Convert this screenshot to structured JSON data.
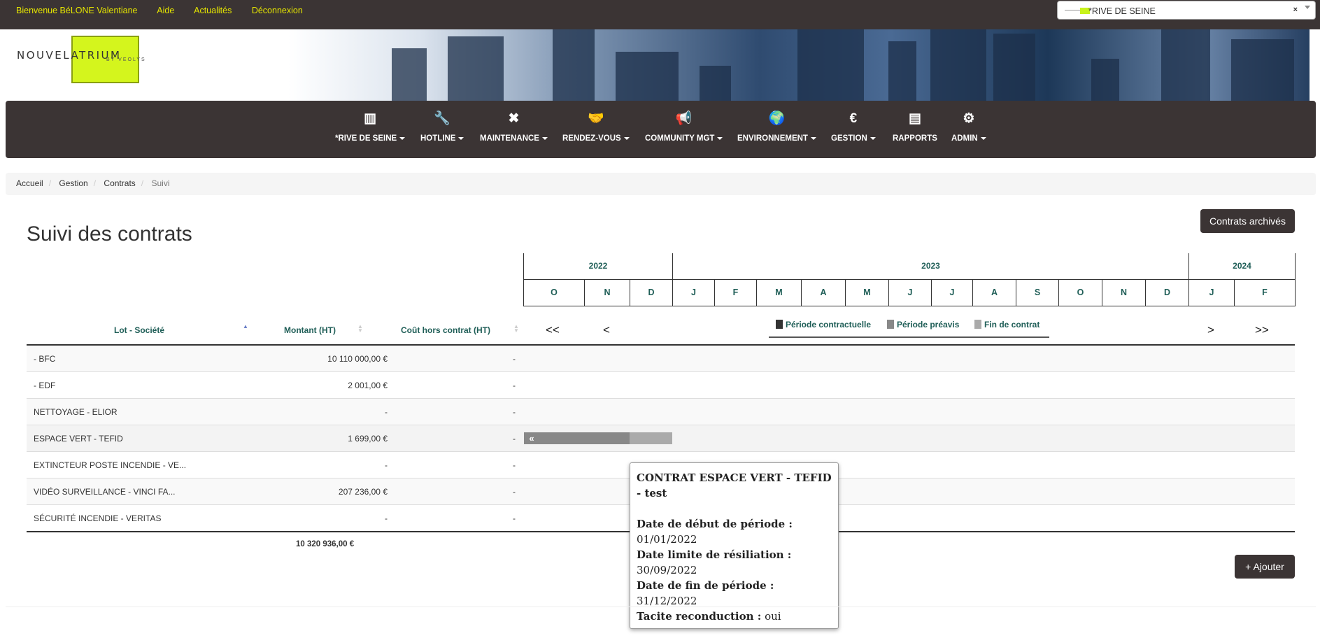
{
  "topbar": {
    "welcome": "Bienvenue BéLONE Valentiane",
    "help": "Aide",
    "news": "Actualités",
    "logout": "Déconnexion",
    "site_select": {
      "value": "*RIVE DE SEINE",
      "clear": "×"
    }
  },
  "logo": {
    "text": "NOUVELATRIUM",
    "subtext": "BY VEOLYS"
  },
  "nav": [
    {
      "label": "*RIVE DE SEINE",
      "icon": "building-icon",
      "glyph": "▥",
      "caret": true
    },
    {
      "label": "HOTLINE",
      "icon": "wrench-icon",
      "glyph": "🔧",
      "caret": true
    },
    {
      "label": "MAINTENANCE",
      "icon": "tools-icon",
      "glyph": "✖",
      "caret": true
    },
    {
      "label": "RENDEZ-VOUS",
      "icon": "handshake-icon",
      "glyph": "🤝",
      "caret": true
    },
    {
      "label": "COMMUNITY MGT",
      "icon": "megaphone-icon",
      "glyph": "📢",
      "caret": true
    },
    {
      "label": "ENVIRONNEMENT",
      "icon": "globe-icon",
      "glyph": "🌍",
      "caret": true
    },
    {
      "label": "GESTION",
      "icon": "euro-icon",
      "glyph": "€",
      "caret": true
    },
    {
      "label": "RAPPORTS",
      "icon": "report-icon",
      "glyph": "▤",
      "caret": false
    },
    {
      "label": "ADMIN",
      "icon": "gear-icon",
      "glyph": "⚙",
      "caret": true
    }
  ],
  "breadcrumb": [
    "Accueil",
    "Gestion",
    "Contrats",
    "Suivi"
  ],
  "page": {
    "title": "Suivi des contrats",
    "archived_button": "Contrats archivés",
    "add_button": "+ Ajouter"
  },
  "timeline": {
    "years": [
      "2022",
      "2023",
      "2024"
    ],
    "months": [
      "O",
      "N",
      "D",
      "J",
      "F",
      "M",
      "A",
      "M",
      "J",
      "J",
      "A",
      "S",
      "O",
      "N",
      "D",
      "J",
      "F"
    ],
    "nav": {
      "first": "<<",
      "prev": "<",
      "next": ">",
      "last": ">>"
    },
    "legend": [
      {
        "label": "Période contractuelle",
        "color": "#333333"
      },
      {
        "label": "Période préavis",
        "color": "#888888"
      },
      {
        "label": "Fin de contrat",
        "color": "#aaaaaa"
      }
    ]
  },
  "table": {
    "headers": {
      "lot": "Lot - Société",
      "montant": "Montant (HT)",
      "cout": "Coût hors contrat (HT)"
    },
    "rows": [
      {
        "lot": "- BFC",
        "montant": "10 110 000,00 €",
        "cout": "-"
      },
      {
        "lot": "- EDF",
        "montant": "2 001,00 €",
        "cout": "-"
      },
      {
        "lot": "NETTOYAGE - ELIOR",
        "montant": "-",
        "cout": "-"
      },
      {
        "lot": "ESPACE VERT - TEFID",
        "montant": "1 699,00 €",
        "cout": "-"
      },
      {
        "lot": "EXTINCTEUR POSTE INCENDIE - VE...",
        "montant": "-",
        "cout": "-"
      },
      {
        "lot": "VIDÉO SURVEILLANCE - VINCI FA...",
        "montant": "207 236,00 €",
        "cout": "-"
      },
      {
        "lot": "SÉCURITÉ INCENDIE - VERITAS",
        "montant": "-",
        "cout": "-"
      }
    ],
    "total": "10 320 936,00 €"
  },
  "tooltip": {
    "title": "CONTRAT ESPACE VERT - TEFID - test",
    "start_label": "Date de début de période :",
    "start": "01/01/2022",
    "limit_label": "Date limite de résiliation :",
    "limit": "30/09/2022",
    "end_label": "Date de fin de période :",
    "end": "31/12/2022",
    "renew_label": "Tacite reconduction :",
    "renew": "oui"
  }
}
